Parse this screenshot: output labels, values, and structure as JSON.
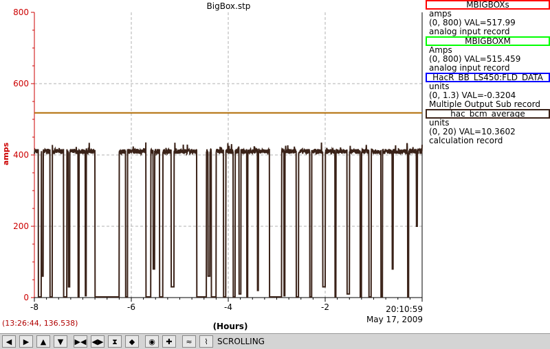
{
  "title": "BigBox.stp",
  "cursor_readout": "(13:26:44, 136.538)",
  "timestamp_line1": "20:10:59",
  "timestamp_line2": "May 17, 2009",
  "legend": [
    {
      "name": "MBIGBOXs",
      "color": "#ff0000",
      "units": "amps",
      "range": "(0, 800)  VAL=517.99",
      "rtype": "analog input record"
    },
    {
      "name": "MBIGBOXM",
      "color": "#00ff00",
      "units": "Amps",
      "range": "(0, 800)  VAL=515.459",
      "rtype": "analog input record"
    },
    {
      "name": "HacR_BB_LS450:FLD_DATA",
      "color": "#0000ff",
      "units": "units",
      "range": "(0, 1.3)  VAL=-0.3204",
      "rtype": "Multiple Output Sub record"
    },
    {
      "name": "hac_bcm_average",
      "color": "#3a2218",
      "units": "units",
      "range": "(0, 20)  VAL=10.3602",
      "rtype": "calculation record"
    }
  ],
  "toolbar": {
    "status": "SCROLLING",
    "icons": [
      "arrow-left-icon",
      "arrow-right-icon",
      "arrow-up-icon",
      "arrow-down-icon",
      "zoom-in-x-icon",
      "zoom-out-x-icon",
      "zoom-in-y-icon",
      "zoom-out-y-icon",
      "autoscale-icon",
      "add-pv-icon",
      "strip-chart-icon"
    ]
  },
  "chart_data": {
    "type": "line",
    "title": "BigBox.stp",
    "xlabel": "(Hours)",
    "ylabel": "amps",
    "xlim": [
      -8.0,
      0.0
    ],
    "ylim": [
      0,
      800
    ],
    "x_ticks": [
      -8,
      -6,
      -4,
      -2
    ],
    "x_tick_labels": [
      "-8",
      "-6",
      "-4",
      "-2"
    ],
    "y_ticks": [
      0,
      200,
      400,
      600,
      800
    ],
    "y_tick_labels": [
      "0",
      "200",
      "400",
      "600",
      "800"
    ],
    "grid": true,
    "series": [
      {
        "name": "MBIGBOXs",
        "color": "#b06a00",
        "x": [
          -8.0,
          0.0
        ],
        "values": [
          518,
          518
        ]
      },
      {
        "name": "hac_bcm_average",
        "color": "#3a2218",
        "baseline": 410,
        "dropouts": [
          [
            -7.92,
            -7.86,
            2
          ],
          [
            -7.85,
            -7.82,
            60
          ],
          [
            -7.68,
            -7.63,
            2
          ],
          [
            -7.4,
            -7.33,
            2
          ],
          [
            -7.3,
            -7.27,
            30
          ],
          [
            -7.1,
            -7.08,
            2
          ],
          [
            -6.95,
            -6.93,
            5
          ],
          [
            -6.75,
            -6.25,
            2
          ],
          [
            -6.48,
            -6.4,
            10
          ],
          [
            -6.3,
            -6.25,
            2
          ],
          [
            -6.12,
            -6.08,
            2
          ],
          [
            -5.7,
            -5.6,
            2
          ],
          [
            -5.55,
            -5.52,
            80
          ],
          [
            -5.42,
            -5.35,
            2
          ],
          [
            -5.18,
            -5.12,
            30
          ],
          [
            -4.65,
            -4.45,
            2
          ],
          [
            -4.42,
            -4.38,
            60
          ],
          [
            -4.35,
            -4.25,
            2
          ],
          [
            -4.1,
            -4.05,
            2
          ],
          [
            -3.9,
            -3.86,
            2
          ],
          [
            -3.78,
            -3.74,
            10
          ],
          [
            -3.62,
            -3.6,
            2
          ],
          [
            -3.4,
            -3.38,
            20
          ],
          [
            -3.15,
            -2.9,
            2
          ],
          [
            -2.85,
            -2.83,
            5
          ],
          [
            -2.6,
            -2.55,
            2
          ],
          [
            -2.32,
            -2.28,
            2
          ],
          [
            -2.05,
            -2.0,
            30
          ],
          [
            -1.8,
            -1.78,
            2
          ],
          [
            -1.55,
            -1.5,
            10
          ],
          [
            -1.28,
            -1.25,
            2
          ],
          [
            -1.1,
            -1.05,
            2
          ],
          [
            -0.85,
            -0.82,
            2
          ],
          [
            -0.62,
            -0.6,
            80
          ],
          [
            -0.3,
            -0.28,
            2
          ],
          [
            -0.12,
            -0.1,
            200
          ]
        ]
      }
    ]
  }
}
